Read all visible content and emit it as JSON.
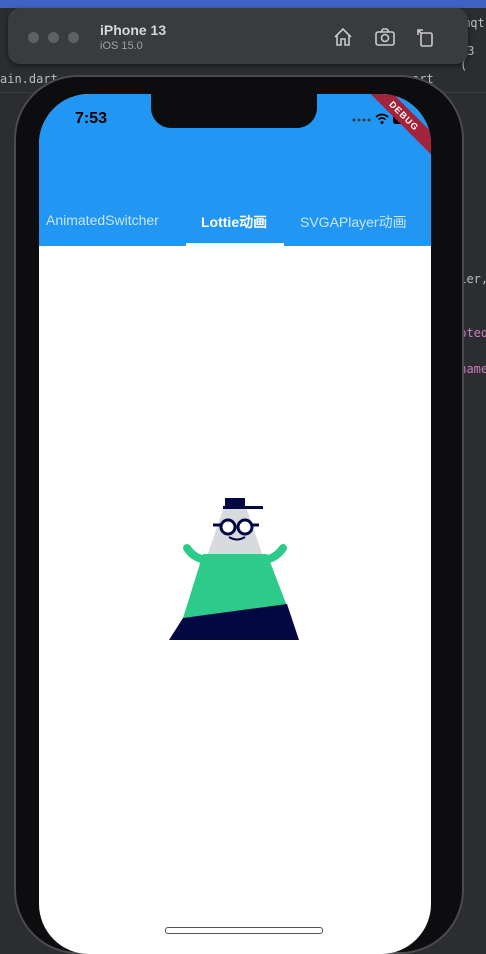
{
  "ide": {
    "tab_left": "ain.dart",
    "tab_right_1": "art",
    "tab_right_2": "mqt",
    "device_suffix": "13 (",
    "code_1": "fier,",
    "code_2": "epted",
    "code_3": "rname"
  },
  "simulator": {
    "device_name": "iPhone 13",
    "os_version": "iOS 15.0",
    "icons": [
      "home-icon",
      "screenshot-icon",
      "rotate-icon"
    ]
  },
  "status_bar": {
    "time": "7:53",
    "icons": [
      "signal-dots-icon",
      "wifi-icon",
      "battery-icon"
    ]
  },
  "debug_banner": "DEBUG",
  "tabs": [
    {
      "label": "AnimatedSwitcher",
      "active": false
    },
    {
      "label": "Lottie动画",
      "active": true
    },
    {
      "label": "SVGAPlayer动画",
      "active": false
    }
  ],
  "colors": {
    "app_bar": "#2196f3",
    "debug_banner": "#a2233a",
    "figure_green": "#2ccb8a",
    "figure_navy": "#030842",
    "figure_gray": "#d9dadd"
  }
}
